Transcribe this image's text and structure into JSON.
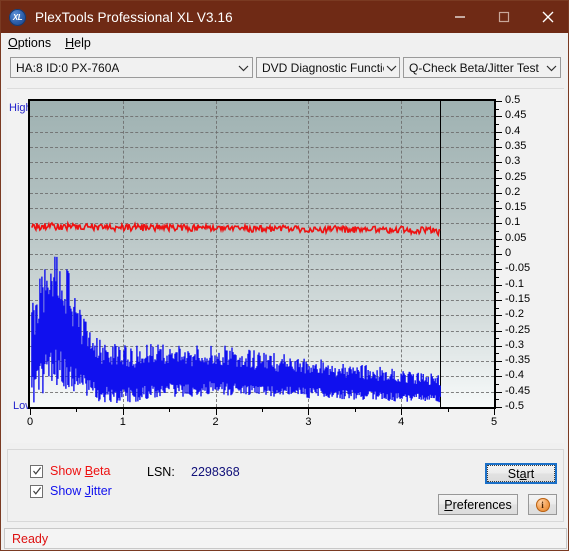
{
  "window": {
    "title": "PlexTools Professional XL V3.16",
    "icon": "xl-logo-icon",
    "icon_text": "XL",
    "minimize_label": "minimize-icon",
    "maximize_label": "maximize-icon",
    "close_label": "close-icon",
    "titlebar_color": "#6f2a15"
  },
  "menu": {
    "items": [
      {
        "label": "Options",
        "accel": "O",
        "rest": "ptions"
      },
      {
        "label": "Help",
        "accel": "H",
        "rest": "elp"
      }
    ]
  },
  "toolbar": {
    "drive_combo": {
      "value": "HA:8 ID:0  PX-760A"
    },
    "function_combo": {
      "value": "DVD Diagnostic Functions"
    },
    "test_combo": {
      "value": "Q-Check Beta/Jitter Test"
    }
  },
  "chart_data": {
    "type": "line",
    "title": "Q-Check Beta/Jitter Test",
    "xlabel": "",
    "ylabel": "",
    "top_label": "High",
    "bottom_label": "Low",
    "xlim": [
      0,
      5
    ],
    "ylim": [
      -0.5,
      0.5
    ],
    "xticks": [
      0,
      1,
      2,
      3,
      4,
      5
    ],
    "xtick_labels": [
      "0",
      "1",
      "2",
      "3",
      "4",
      "5"
    ],
    "yticks": [
      0.5,
      0.45,
      0.4,
      0.35,
      0.3,
      0.25,
      0.2,
      0.15,
      0.1,
      0.05,
      0,
      -0.05,
      -0.1,
      -0.15,
      -0.2,
      -0.25,
      -0.3,
      -0.35,
      -0.4,
      -0.45,
      -0.5
    ],
    "ytick_labels": [
      "0.5",
      "0.45",
      "0.4",
      "0.35",
      "0.3",
      "0.25",
      "0.2",
      "0.15",
      "0.1",
      "0.05",
      "0",
      "-0.05",
      "-0.1",
      "-0.15",
      "-0.2",
      "-0.25",
      "-0.3",
      "-0.35",
      "-0.4",
      "-0.45",
      "-0.5"
    ],
    "grid": true,
    "grid_style": "dashed",
    "grid_color": "#6c6c6c",
    "plot_bg_top": "#9fb2b2",
    "plot_bg_bottom": "#f7fafa",
    "cursor_x": 4.42,
    "data_end_x": 4.42,
    "legend_position": "bottom-left",
    "series": [
      {
        "name": "Beta",
        "color": "#ee1111",
        "visible": true,
        "x_start": 0.02,
        "x_end": 4.42,
        "mean": 0.085,
        "noise": 0.012,
        "trend_end": 0.072,
        "values": [
          0.09,
          0.089,
          0.09,
          0.088,
          0.089,
          0.088,
          0.088,
          0.087,
          0.088,
          0.087,
          0.087,
          0.086,
          0.087,
          0.086,
          0.086,
          0.085,
          0.086,
          0.085,
          0.085,
          0.084,
          0.085,
          0.084,
          0.084,
          0.083,
          0.084,
          0.083,
          0.083,
          0.082,
          0.083,
          0.082,
          0.082,
          0.081,
          0.082,
          0.081,
          0.081,
          0.08,
          0.081,
          0.08,
          0.08,
          0.079,
          0.08,
          0.079,
          0.079,
          0.078,
          0.079,
          0.078,
          0.078,
          0.077,
          0.076,
          0.072
        ]
      },
      {
        "name": "Jitter",
        "color": "#1111ee",
        "visible": true,
        "x_start": 0.02,
        "x_end": 4.42,
        "band_center_start": -0.375,
        "band_center_end": -0.435,
        "band_width_start": 0.11,
        "band_width_end": 0.045,
        "values": [
          -0.38,
          -0.35,
          -0.33,
          -0.325,
          -0.335,
          -0.35,
          -0.365,
          -0.385,
          -0.4,
          -0.405,
          -0.41,
          -0.412,
          -0.408,
          -0.405,
          -0.402,
          -0.4,
          -0.398,
          -0.396,
          -0.398,
          -0.4,
          -0.395,
          -0.392,
          -0.39,
          -0.392,
          -0.396,
          -0.4,
          -0.402,
          -0.404,
          -0.406,
          -0.408,
          -0.41,
          -0.412,
          -0.414,
          -0.416,
          -0.418,
          -0.42,
          -0.422,
          -0.424,
          -0.426,
          -0.428,
          -0.43,
          -0.432,
          -0.434,
          -0.436,
          -0.438,
          -0.44,
          -0.442,
          -0.444,
          -0.446,
          -0.448
        ]
      }
    ]
  },
  "controls": {
    "show_beta": {
      "label_accel_before": "Show ",
      "label_accel": "B",
      "label_accel_after": "eta",
      "checked": true,
      "color": "#ee1111"
    },
    "show_jitter": {
      "label_accel_before": "Show ",
      "label_accel": "J",
      "label_accel_after": "itter",
      "checked": true,
      "color": "#1111ee"
    },
    "lsn_label": "LSN:",
    "lsn_value": "2298368",
    "start_button": {
      "before": "St",
      "accel": "a",
      "after": "rt"
    },
    "preferences_button": {
      "before": "",
      "accel": "P",
      "after": "references"
    },
    "info_button": {
      "icon": "info-icon",
      "glyph": "i"
    }
  },
  "status": {
    "text": "Ready",
    "color": "#dd1111"
  }
}
